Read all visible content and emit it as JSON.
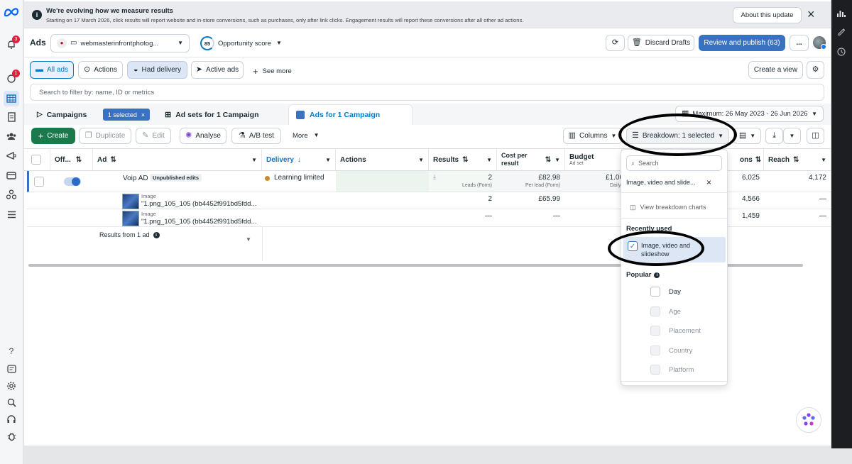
{
  "banner": {
    "title": "We're evolving how we measure results",
    "text": "Starting on 17 March 2026, click results will report website and in-store conversions, such as purchases, only after link clicks. Engagement results will report these conversions after all other ad actions.",
    "about_label": "About this update"
  },
  "header": {
    "title": "Ads",
    "account_name": "webmasterinfrontphotog...",
    "opportunity_score": "85",
    "opportunity_label": "Opportunity score",
    "discard_label": "Discard Drafts",
    "review_label": "Review and publish (63)",
    "more_label": "..."
  },
  "rail": {
    "notif_badge": "3",
    "ads_badge": "1"
  },
  "filters": {
    "all_ads": "All ads",
    "actions": "Actions",
    "had_delivery": "Had delivery",
    "active_ads": "Active ads",
    "see_more": "See more",
    "create_view": "Create a view",
    "search_placeholder": "Search to filter by: name, ID or metrics"
  },
  "tabs": {
    "campaigns": "Campaigns",
    "selected": "1 selected",
    "adsets": "Ad sets for 1 Campaign",
    "ads": "Ads for 1 Campaign",
    "date_range": "Maximum: 26 May 2023 - 26 Jun 2026"
  },
  "toolbar": {
    "create": "Create",
    "duplicate": "Duplicate",
    "edit": "Edit",
    "analyse": "Analyse",
    "ab_test": "A/B test",
    "more": "More",
    "columns": "Columns",
    "breakdown": "Breakdown: 1 selected"
  },
  "table": {
    "headers": {
      "off": "Off...",
      "ad": "Ad",
      "delivery": "Delivery",
      "actions": "Actions",
      "results": "Results",
      "cost": "Cost per result",
      "budget": "Budget",
      "budget_sub": "Ad set",
      "impressions": "ons",
      "reach": "Reach"
    },
    "row": {
      "ad_name": "Voip AD",
      "badge": "Unpublished edits",
      "delivery": "Learning limited",
      "results": "2",
      "results_sub": "Leads (Form)",
      "cost": "£82.98",
      "cost_sub": "Per lead (Form)",
      "budget": "£1.00",
      "budget_sub": "Daily",
      "impressions": "6,025",
      "reach": "4,172"
    },
    "sub_rows": [
      {
        "type": "Image",
        "name": "\"1.png_105_105 (bb4452f991bd5fdd...",
        "results": "2",
        "cost": "£65.99",
        "impressions": "4,566",
        "reach": "—"
      },
      {
        "type": "Image",
        "name": "\"1.png_105_105 (bb4452f991bd5fdd...",
        "results": "—",
        "cost": "—",
        "impressions": "1,459",
        "reach": "—"
      }
    ],
    "footer": "Results from 1 ad"
  },
  "breakdown_menu": {
    "search_placeholder": "Search",
    "selected_chip": "Image, video and slide...",
    "view_charts": "View breakdown charts",
    "recently_used_title": "Recently used",
    "recent_item": "Image, video and slideshow",
    "popular_title": "Popular",
    "popular_items": [
      "Day",
      "Age",
      "Placement",
      "Country",
      "Platform"
    ]
  },
  "colors": {
    "accent": "#0a78be",
    "primary_button": "#3a72c2",
    "create_button": "#1b7a4b",
    "delivery_dot": "#c98a2b",
    "selected_bg": "#dce6f5"
  }
}
